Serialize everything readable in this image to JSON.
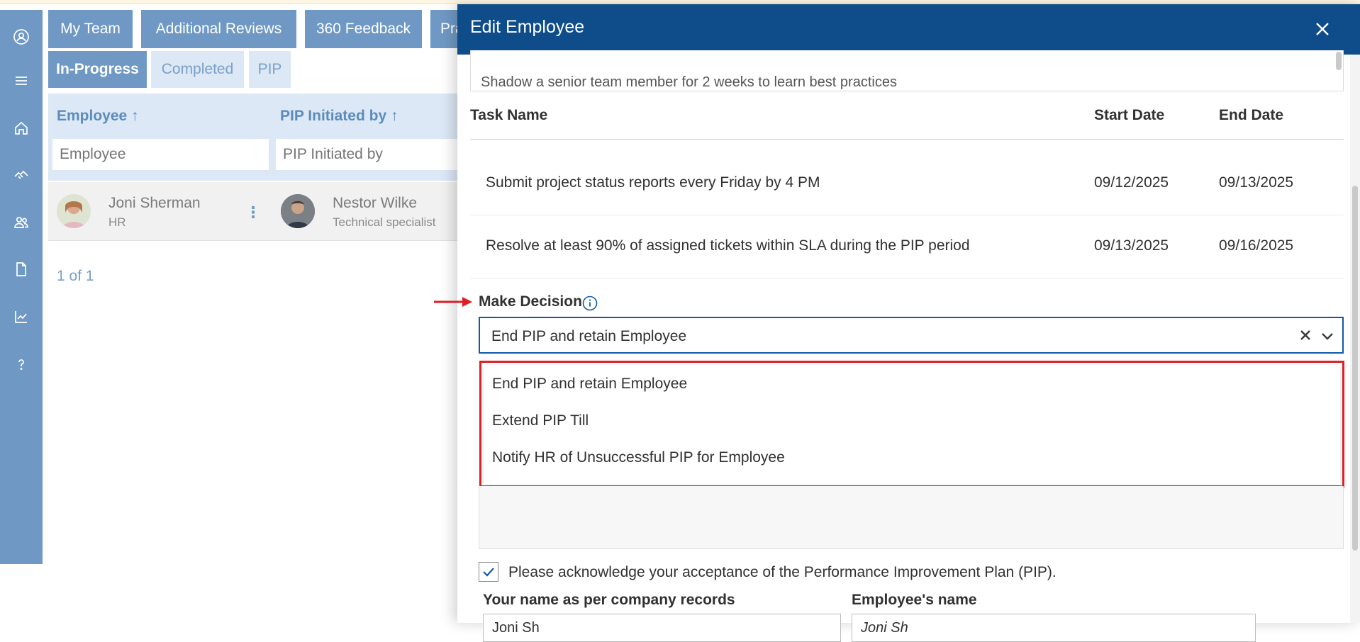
{
  "app": {
    "tabs": [
      {
        "label": "My Team"
      },
      {
        "label": "Additional Reviews"
      },
      {
        "label": "360 Feedback"
      },
      {
        "label": "Pra"
      }
    ],
    "subtabs": [
      {
        "label": "In-Progress",
        "active": true
      },
      {
        "label": "Completed",
        "active": false
      },
      {
        "label": "PIP",
        "active": false
      }
    ],
    "grid": {
      "columns": [
        {
          "title": "Employee ↑",
          "filter_placeholder": "Employee"
        },
        {
          "title": "PIP Initiated by ↑",
          "filter_placeholder": "PIP Initiated by"
        }
      ],
      "rows": [
        {
          "employee_name": "Joni Sherman",
          "employee_role": "HR",
          "initiator_name": "Nestor Wilke",
          "initiator_role": "Technical specialist"
        }
      ],
      "pager": "1 of 1"
    },
    "rail_icons": [
      "logo-icon",
      "menu-icon",
      "home-icon",
      "handshake-icon",
      "people-icon",
      "document-icon",
      "chart-icon",
      "help-icon"
    ]
  },
  "panel": {
    "title": "Edit Employee",
    "prev_text_line": "Shadow a senior team member for 2 weeks to learn best practices",
    "tasks": {
      "headers": {
        "name": "Task Name",
        "start": "Start Date",
        "end": "End Date"
      },
      "rows": [
        {
          "name": "Submit project status reports every Friday by 4 PM",
          "start": "09/12/2025",
          "end": "09/13/2025"
        },
        {
          "name": "Resolve at least 90% of assigned tickets within SLA during the PIP period",
          "start": "09/13/2025",
          "end": "09/16/2025"
        }
      ]
    },
    "decision": {
      "label": "Make Decision",
      "selected": "End PIP and retain Employee",
      "options": [
        "End PIP and retain Employee",
        "Extend PIP Till",
        "Notify HR of Unsuccessful PIP for Employee"
      ]
    },
    "acknowledge": {
      "checked": true,
      "text": "Please acknowledge your acceptance of the Performance Improvement Plan (PIP)."
    },
    "name_fields": {
      "company_label": "Your name as per company records",
      "company_value": "Joni Sh",
      "employee_label": "Employee's name",
      "employee_value": "Joni Sh"
    }
  },
  "colors": {
    "header_blue": "#0f4c8a",
    "rail_blue": "#6f99c4",
    "highlight_red": "#e01e26"
  }
}
